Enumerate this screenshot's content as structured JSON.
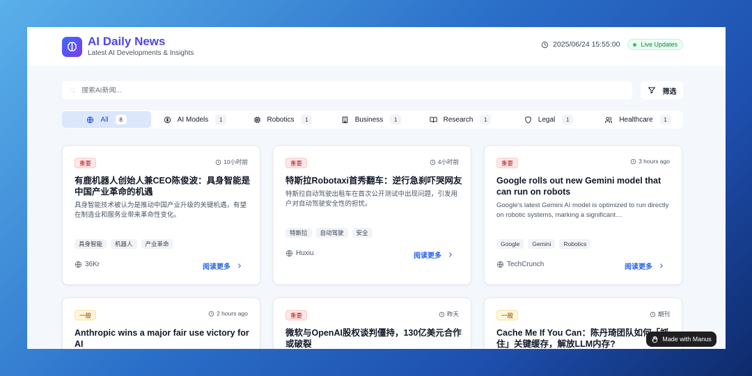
{
  "header": {
    "title": "AI Daily News",
    "subtitle": "Latest AI Developments & Insights",
    "datetime": "2025/06/24 15:55:00",
    "live_label": "Live Updates",
    "accent_color": "#4f46e5"
  },
  "search": {
    "placeholder": "搜索AI新闻...",
    "value": "",
    "filter_label": "筛选"
  },
  "tabs": [
    {
      "label": "All",
      "count": "8",
      "icon": "globe-icon",
      "active": true
    },
    {
      "label": "AI Models",
      "count": "1",
      "icon": "brain-icon",
      "active": false
    },
    {
      "label": "Robotics",
      "count": "1",
      "icon": "cpu-icon",
      "active": false
    },
    {
      "label": "Business",
      "count": "1",
      "icon": "building-icon",
      "active": false
    },
    {
      "label": "Research",
      "count": "1",
      "icon": "book-icon",
      "active": false
    },
    {
      "label": "Legal",
      "count": "1",
      "icon": "shield-icon",
      "active": false
    },
    {
      "label": "Healthcare",
      "count": "1",
      "icon": "users-icon",
      "active": false
    }
  ],
  "cards": [
    {
      "badge": "重要",
      "badge_type": "important",
      "time": "10小时前",
      "title": "有鹿机器人创始人兼CEO陈俊波：具身智能是中国产业革命的机遇",
      "summary": "具身智能技术被认为是推动中国产业升级的关键机遇，有望在制造业和服务业带来革命性变化。",
      "tags": [
        "具身智能",
        "机器人",
        "产业革命"
      ],
      "source": "36Kr",
      "read_more": "阅读更多"
    },
    {
      "badge": "重要",
      "badge_type": "important",
      "time": "4小时前",
      "title": "特斯拉Robotaxi首秀翻车：逆行急刹吓哭网友",
      "summary": "特斯拉自动驾驶出租车在首次公开测试中出现问题，引发用户对自动驾驶安全性的担忧。",
      "tags": [
        "特斯拉",
        "自动驾驶",
        "安全"
      ],
      "source": "Huxiu",
      "read_more": "阅读更多"
    },
    {
      "badge": "重要",
      "badge_type": "important",
      "time": "3 hours ago",
      "title": "Google rolls out new Gemini model that can run on robots",
      "summary": "Google's latest Gemini AI model is optimized to run directly on robotic systems, marking a significant…",
      "tags": [
        "Google",
        "Gemini",
        "Robotics"
      ],
      "source": "TechCrunch",
      "read_more": "阅读更多"
    },
    {
      "badge": "一般",
      "badge_type": "normal",
      "time": "2 hours ago",
      "title": "Anthropic wins a major fair use victory for AI",
      "summary": "",
      "tags": [],
      "source": "",
      "read_more": ""
    },
    {
      "badge": "重要",
      "badge_type": "important",
      "time": "昨天",
      "title": "微软与OpenAI股权谈判僵持，130亿美元合作或破裂",
      "summary": "",
      "tags": [],
      "source": "",
      "read_more": ""
    },
    {
      "badge": "一般",
      "badge_type": "normal",
      "time": "期刊",
      "title": "Cache Me If You Can：陈丹琦团队如何「抓住」关键缓存，解放LLM内存?",
      "summary": "",
      "tags": [],
      "source": "",
      "read_more": ""
    }
  ],
  "watermark": "Made with Manus"
}
